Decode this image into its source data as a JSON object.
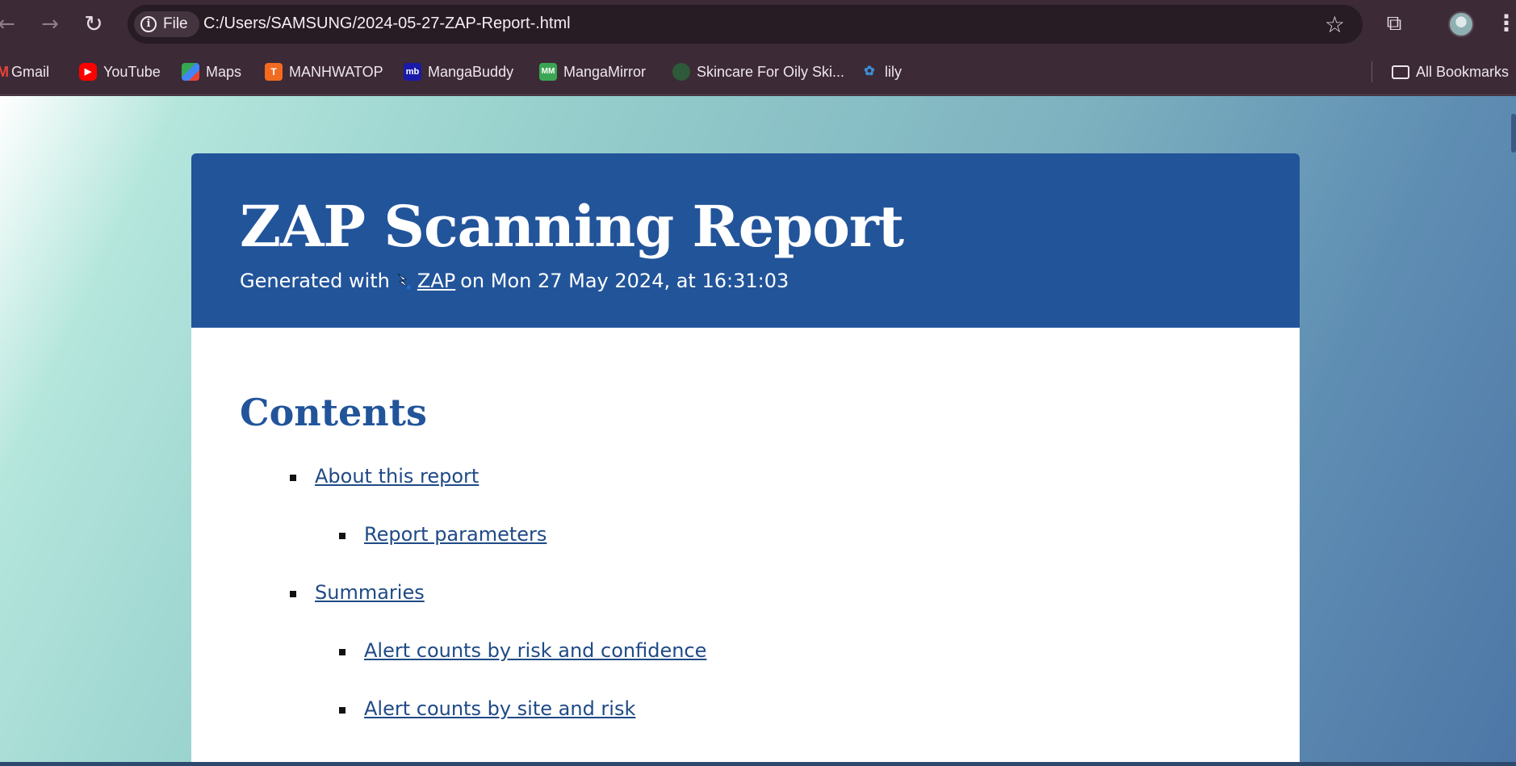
{
  "browser": {
    "address_chip": "File",
    "url": "C:/Users/SAMSUNG/2024-05-27-ZAP-Report-.html",
    "bookmarks": [
      {
        "label": "Gmail",
        "icon": "gmail-icon",
        "color": "#ea4335"
      },
      {
        "label": "YouTube",
        "icon": "youtube-icon",
        "color": "#ff0000"
      },
      {
        "label": "Maps",
        "icon": "maps-icon",
        "color": "#34a853"
      },
      {
        "label": "MANHWATOP",
        "icon": "manhwatop-icon",
        "color": "#f26b21"
      },
      {
        "label": "MangaBuddy",
        "icon": "mangabuddy-icon",
        "color": "#1a1aa8"
      },
      {
        "label": "MangaMirror",
        "icon": "mangamirror-icon",
        "color": "#3aa653"
      },
      {
        "label": "Skincare For Oily Ski...",
        "icon": "skincare-icon",
        "color": "#2f5a3a"
      },
      {
        "label": "lily",
        "icon": "lily-icon",
        "color": "#3b8fd6"
      }
    ],
    "all_bookmarks": "All Bookmarks"
  },
  "report": {
    "title": "ZAP Scanning Report",
    "generated_prefix": "Generated with",
    "generated_link": "ZAP",
    "generated_suffix": "on Mon 27 May 2024, at 16:31:03",
    "contents_heading": "Contents",
    "toc": [
      {
        "label": "About this report",
        "level": 1
      },
      {
        "label": "Report parameters",
        "level": 2
      },
      {
        "label": "Summaries",
        "level": 1
      },
      {
        "label": "Alert counts by risk and confidence",
        "level": 2
      },
      {
        "label": "Alert counts by site and risk",
        "level": 2
      }
    ]
  },
  "colors": {
    "header_blue": "#22549a",
    "link_blue": "#1f4a86"
  }
}
